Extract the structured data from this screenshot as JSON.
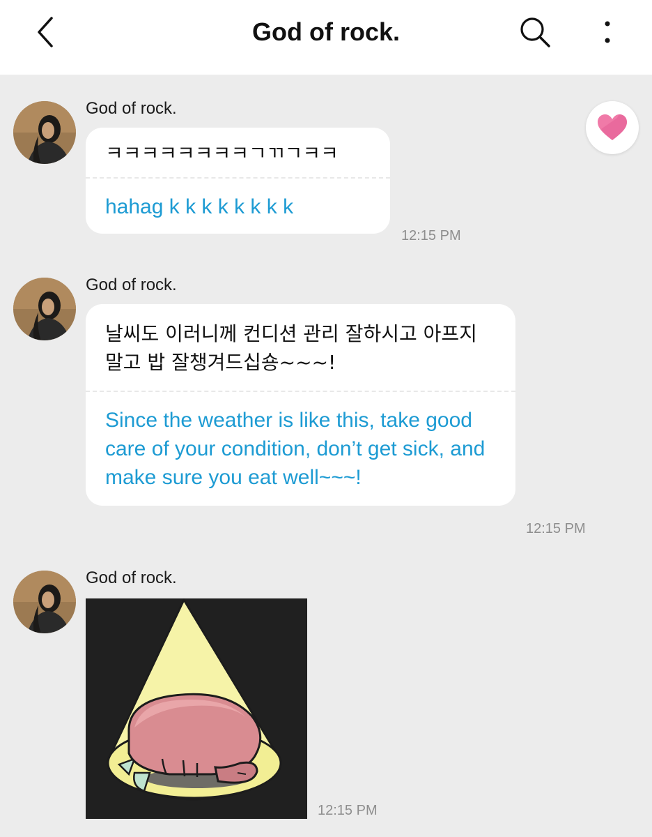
{
  "header": {
    "title": "God of rock.",
    "back_icon": "chevron-left-icon",
    "search_icon": "search-icon",
    "more_icon": "more-vertical-icon"
  },
  "messages": [
    {
      "sender": "God of rock.",
      "original": "ㅋㅋㅋㅋㅋㅋㅋㅋㄱㄲㄱㅋㅋ",
      "translation": "hahag k k k k k k k k",
      "time": "12:15 PM"
    },
    {
      "sender": "God of rock.",
      "original": "날씨도 이러니께 컨디션 관리 잘하시고 아프지 말고 밥 잘챙겨드십숑~~~!",
      "translation": "Since the weather is like this, take good care of your condition, don’t get sick, and make sure you eat well~~~!",
      "time": "12:15 PM"
    },
    {
      "sender": "God of rock.",
      "sticker": "sleeping-pink-creature-spotlight-sticker",
      "time": "12:15 PM"
    }
  ],
  "reaction_icon": "heart-icon",
  "colors": {
    "background": "#ececec",
    "bubble": "#ffffff",
    "translation_text": "#1d9bd3",
    "heart": "#f07aa8"
  }
}
